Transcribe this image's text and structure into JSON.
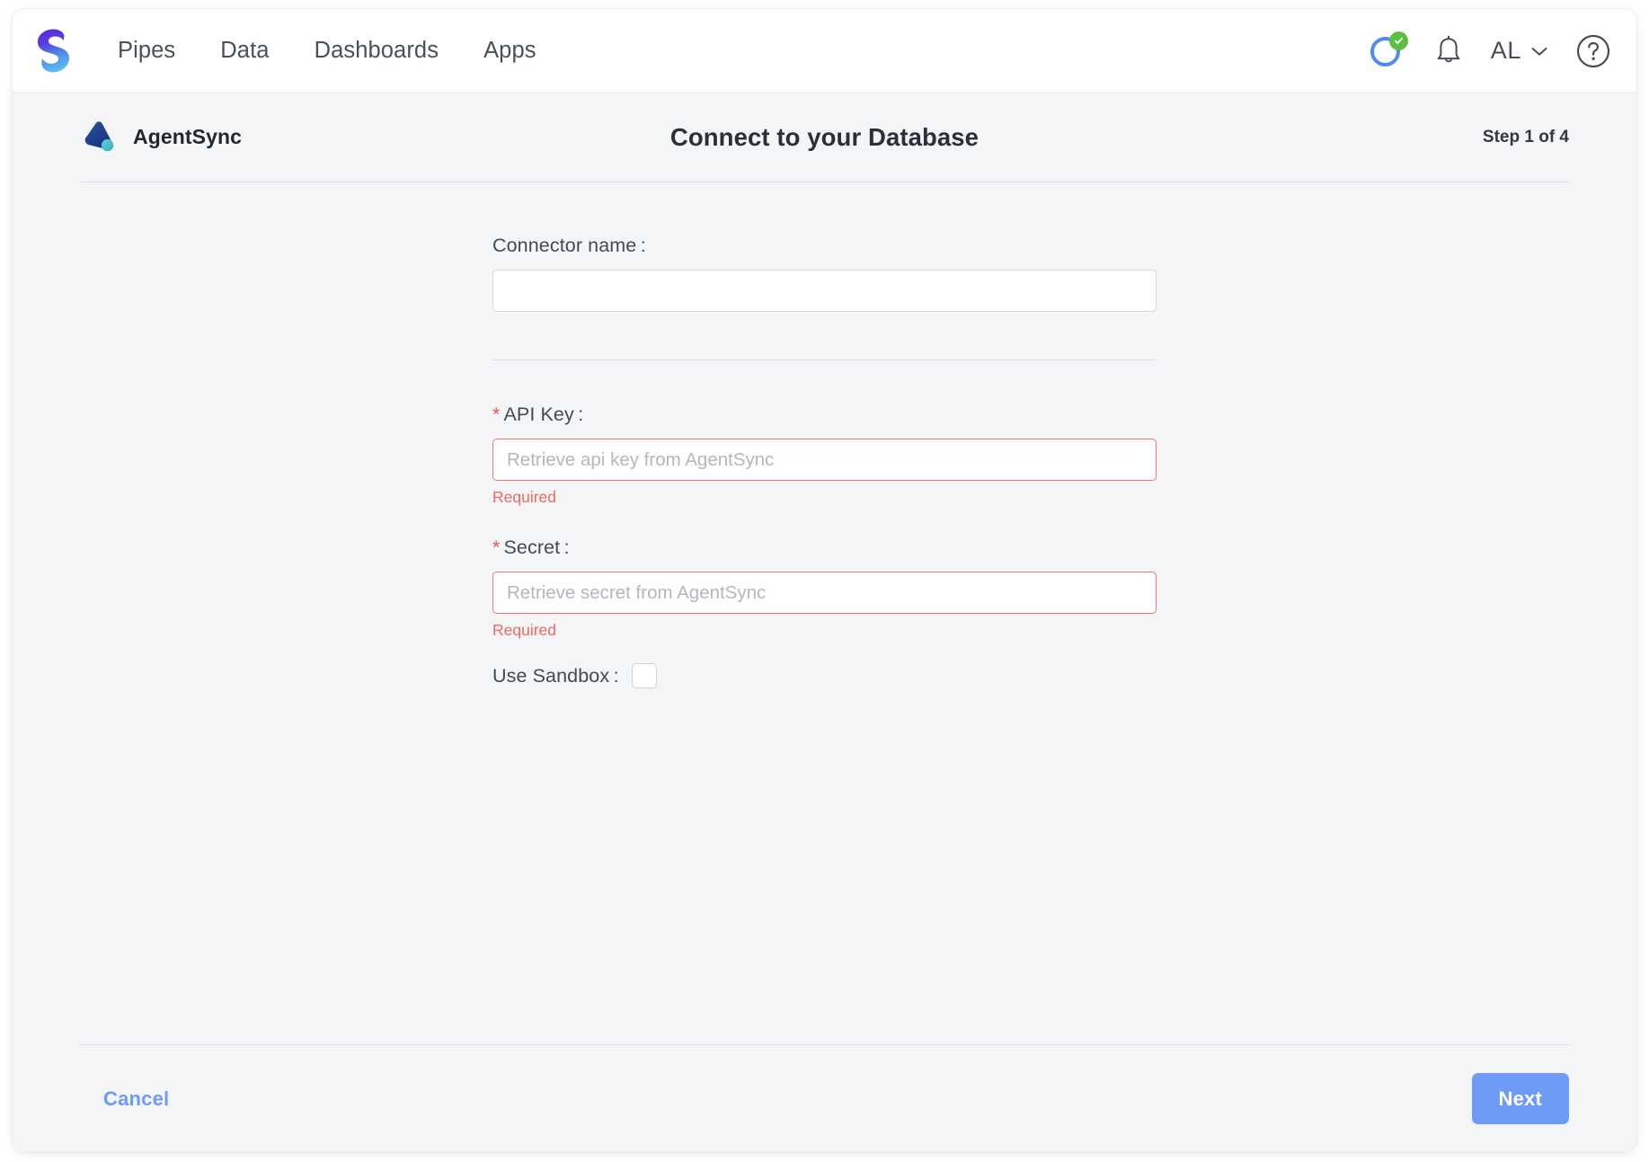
{
  "app": {
    "logo_icon": "sisense-s-logo",
    "nav": [
      {
        "label": "Pipes"
      },
      {
        "label": "Data"
      },
      {
        "label": "Dashboards"
      },
      {
        "label": "Apps"
      }
    ],
    "status_indicator": {
      "icon": "sync-status-ring-icon",
      "badge_icon": "check-badge-icon",
      "ring_color": "#4d8bf0",
      "badge_color": "#5bbf42"
    },
    "notifications_icon": "bell-icon",
    "user": {
      "initials": "AL",
      "chevron_icon": "chevron-down-icon"
    },
    "help_icon": "question-circle-icon"
  },
  "wizard": {
    "connector": {
      "logo_icon": "agentsync-logo",
      "name": "AgentSync"
    },
    "title": "Connect to your Database",
    "step_label": "Step 1 of 4",
    "fields": {
      "connector_name": {
        "label": "Connector name :",
        "value": "",
        "placeholder": ""
      },
      "api_key": {
        "label": "API Key :",
        "required_marker": "*",
        "value": "",
        "placeholder": "Retrieve api key from AgentSync",
        "error": "Required"
      },
      "secret": {
        "label": "Secret :",
        "required_marker": "*",
        "value": "",
        "placeholder": "Retrieve secret from AgentSync",
        "error": "Required"
      },
      "use_sandbox": {
        "label": "Use Sandbox :",
        "checked": false
      }
    },
    "footer": {
      "cancel_label": "Cancel",
      "next_label": "Next"
    }
  },
  "colors": {
    "accent_blue": "#6d9bf6",
    "error_red": "#f0685f",
    "page_bg": "#f4f5f7"
  }
}
